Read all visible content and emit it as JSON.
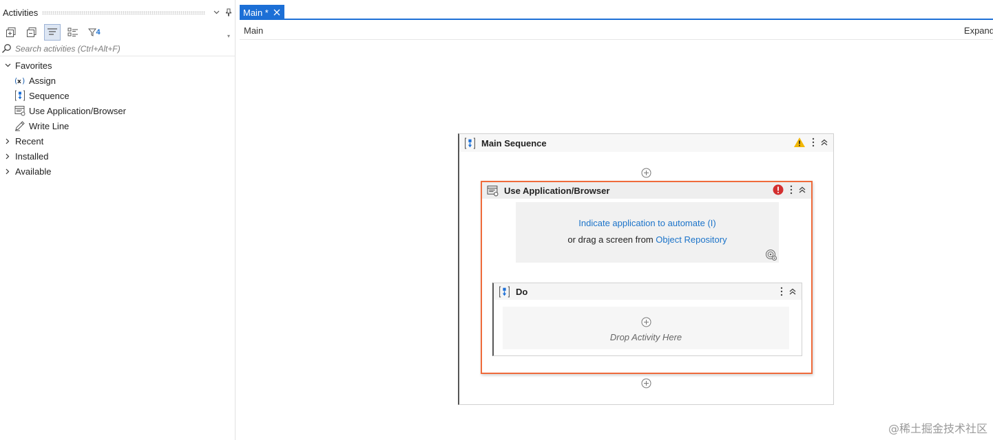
{
  "activities_panel": {
    "title": "Activities",
    "filter_count": "4",
    "search": {
      "placeholder": "Search activities (Ctrl+Alt+F)",
      "value": ""
    },
    "favorites_label": "Favorites",
    "favorites_items": [
      {
        "label": "Assign",
        "icon": "assign-icon"
      },
      {
        "label": "Sequence",
        "icon": "sequence-icon"
      },
      {
        "label": "Use Application/Browser",
        "icon": "browser-window-icon"
      },
      {
        "label": "Write Line",
        "icon": "pencil-icon"
      }
    ],
    "recent_label": "Recent",
    "installed_label": "Installed",
    "available_label": "Available"
  },
  "editor": {
    "tab_label": "Main *",
    "breadcrumb": "Main",
    "expand_label": "Expand",
    "main_sequence": {
      "title": "Main Sequence",
      "status": "warning"
    },
    "use_app": {
      "title": "Use Application/Browser",
      "status": "error",
      "indicate_link": "Indicate application to automate (I)",
      "drag_text": "or drag a screen from",
      "repo_link": "Object Repository"
    },
    "do_block": {
      "title": "Do",
      "drop_text": "Drop Activity Here"
    }
  },
  "watermark": "@稀土掘金技术社区",
  "colors": {
    "accent": "#1c6fd6",
    "selection_border": "#ef6a3a",
    "link": "#1b73c9",
    "warning": "#f2b705",
    "error": "#d32f2f"
  }
}
